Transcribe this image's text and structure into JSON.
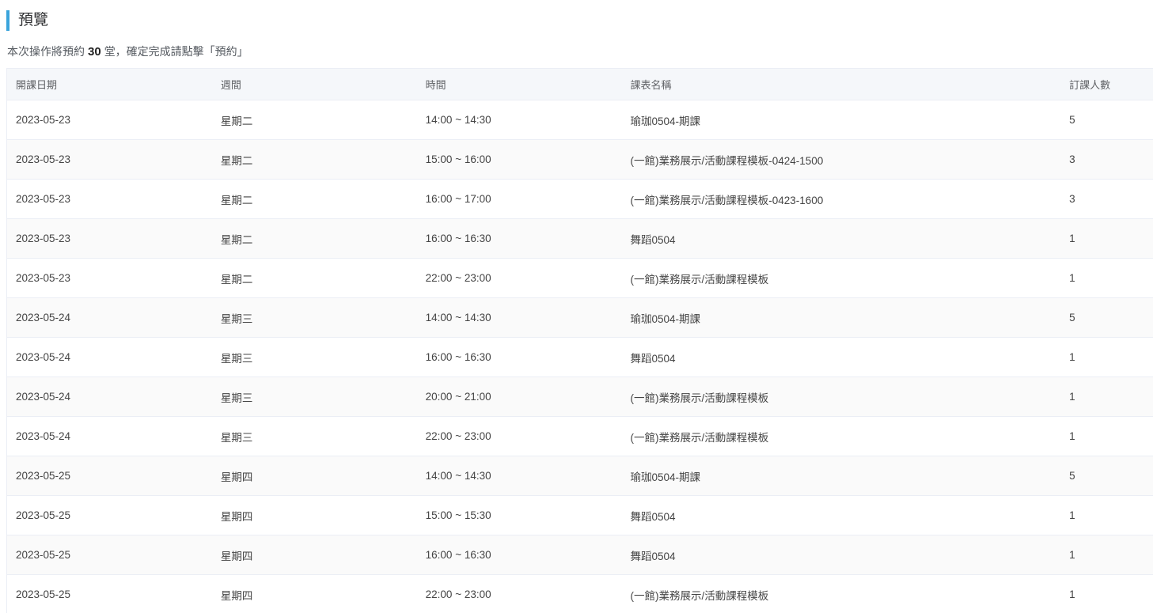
{
  "title": "預覽",
  "summary": {
    "prefix": "本次操作將預約",
    "count": "30",
    "suffix": "堂，確定完成請點擊「預約」"
  },
  "table": {
    "columns": [
      "開課日期",
      "週間",
      "時間",
      "課表名稱",
      "訂課人數"
    ],
    "rows": [
      {
        "date": "2023-05-23",
        "weekday": "星期二",
        "time": "14:00 ~ 14:30",
        "name": "瑜珈0504-期課",
        "count": "5"
      },
      {
        "date": "2023-05-23",
        "weekday": "星期二",
        "time": "15:00 ~ 16:00",
        "name": "(一館)業務展示/活動課程模板-0424-1500",
        "count": "3"
      },
      {
        "date": "2023-05-23",
        "weekday": "星期二",
        "time": "16:00 ~ 17:00",
        "name": "(一館)業務展示/活動課程模板-0423-1600",
        "count": "3"
      },
      {
        "date": "2023-05-23",
        "weekday": "星期二",
        "time": "16:00 ~ 16:30",
        "name": "舞蹈0504",
        "count": "1"
      },
      {
        "date": "2023-05-23",
        "weekday": "星期二",
        "time": "22:00 ~ 23:00",
        "name": "(一館)業務展示/活動課程模板",
        "count": "1"
      },
      {
        "date": "2023-05-24",
        "weekday": "星期三",
        "time": "14:00 ~ 14:30",
        "name": "瑜珈0504-期課",
        "count": "5"
      },
      {
        "date": "2023-05-24",
        "weekday": "星期三",
        "time": "16:00 ~ 16:30",
        "name": "舞蹈0504",
        "count": "1"
      },
      {
        "date": "2023-05-24",
        "weekday": "星期三",
        "time": "20:00 ~ 21:00",
        "name": "(一館)業務展示/活動課程模板",
        "count": "1"
      },
      {
        "date": "2023-05-24",
        "weekday": "星期三",
        "time": "22:00 ~ 23:00",
        "name": "(一館)業務展示/活動課程模板",
        "count": "1"
      },
      {
        "date": "2023-05-25",
        "weekday": "星期四",
        "time": "14:00 ~ 14:30",
        "name": "瑜珈0504-期課",
        "count": "5"
      },
      {
        "date": "2023-05-25",
        "weekday": "星期四",
        "time": "15:00 ~ 15:30",
        "name": "舞蹈0504",
        "count": "1"
      },
      {
        "date": "2023-05-25",
        "weekday": "星期四",
        "time": "16:00 ~ 16:30",
        "name": "舞蹈0504",
        "count": "1"
      },
      {
        "date": "2023-05-25",
        "weekday": "星期四",
        "time": "22:00 ~ 23:00",
        "name": "(一館)業務展示/活動課程模板",
        "count": "1"
      }
    ]
  },
  "colors": {
    "accent": "#3aa4dc",
    "header_bg": "#f5f7fa",
    "stripe_bg": "#fafafa",
    "border": "#ebeef5"
  }
}
